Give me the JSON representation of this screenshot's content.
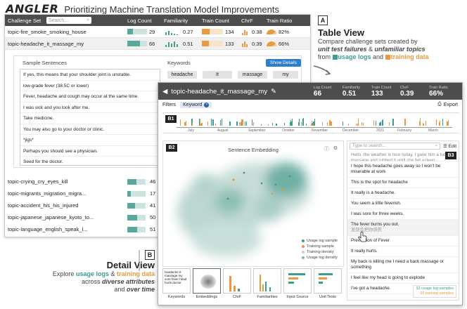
{
  "header": {
    "logo": "ANGLER",
    "subtitle": "Prioritizing Machine Translation Model Improvements"
  },
  "table": {
    "columns": {
      "challenge_set": "Challenge Set",
      "search_placeholder": "Search...",
      "log_count": "Log Count",
      "familiarity": "Familiarity",
      "train_count": "Train Count",
      "chrf": "ChrF",
      "train_ratio": "Train Ratio"
    },
    "rows": [
      {
        "name": "topic-fire_smoke_smoking_house",
        "log_count": "29",
        "familiarity": "0.27",
        "train_count": "134",
        "chrf": "0.38",
        "train_ratio": "82%"
      },
      {
        "name": "topic-headache_it_massage_my",
        "log_count": "66",
        "familiarity": "0.51",
        "train_count": "133",
        "chrf": "0.39",
        "train_ratio": "66%"
      }
    ],
    "expanded": {
      "sample_title": "Sample Sentences",
      "samples": [
        "If yes, this means that your shoulder joint is unstable.",
        "low-grade fever (38.5C or lower)",
        "Fever, headache and cough may occur at the same time.",
        "I was sick and you look after me.",
        "Take medicine.",
        "You may also go to your doctor or clinic.",
        "*jigs*",
        "Perhaps you should see a physician.",
        "Seed for the doctor."
      ],
      "keywords_title": "Keywords",
      "show_details": "Show Details",
      "keywords": [
        "headache",
        "It",
        "massage",
        "my"
      ]
    },
    "more_rows": [
      {
        "name": "topic-crying_cry_eyes_kill",
        "log_count": "46"
      },
      {
        "name": "topic-migrants_migration_migra...",
        "log_count": "17"
      },
      {
        "name": "topic-accident_his_his_injured",
        "log_count": "41"
      },
      {
        "name": "topic-japanese_japanese_kyoto_to...",
        "log_count": "50"
      },
      {
        "name": "topic-language_english_speak_l...",
        "log_count": "51"
      }
    ]
  },
  "annotation_a": {
    "badge": "A",
    "title": "Table View",
    "line1": "Compare challenge sets created by",
    "bold1": "unit test failures",
    "amp": " & ",
    "bold2": "unfamiliar topics",
    "from": "from",
    "usage": "usage logs",
    "and": "and",
    "training": "training data"
  },
  "annotation_b": {
    "badge": "B",
    "title": "Detail View",
    "explore": "Explore",
    "usage": "usage logs",
    "amp": " & ",
    "training": "training data",
    "across": "across",
    "diverse": "diverse attributes",
    "and": "and",
    "overtime": "over time"
  },
  "detail": {
    "title": "topic-headache_it_massage_my",
    "stats": [
      {
        "label": "Log Count",
        "value": "66"
      },
      {
        "label": "Familiarity",
        "value": "0.51"
      },
      {
        "label": "Train Count",
        "value": "133"
      },
      {
        "label": "ChrF",
        "value": "0.39"
      },
      {
        "label": "Train Ratio",
        "value": "66%"
      }
    ],
    "filters_label": "Filters",
    "filter_chip": "Keyword",
    "export": "Export",
    "b1": "B1",
    "b2": "B2",
    "b3": "B3",
    "timeline_labels": [
      "July",
      "August",
      "September",
      "October",
      "November",
      "December",
      "2021",
      "February",
      "March"
    ],
    "embedding_title": "Sentence Embedding",
    "legend": [
      "Usage log sample",
      "Training sample",
      "Training density",
      "Usage log density"
    ],
    "side_search_placeholder": "Type to search...",
    "edit": "Edit",
    "side_items": [
      "Hello, the weather is nice today, I gave him a tummy massage and rubbed it until she fell asleep.",
      "I hope this headache goes away so I won't be miserable at work",
      "This is the spot for headache",
      "It really is a headache.",
      "You seem a little feverish.",
      "I was sore for three weeks.",
      "The fever burns you out.",
      "Prevention of Fever",
      "It really hurts.",
      "My back is killing me I need a back massage or something",
      "I feel like my head is going to explode",
      "I've got a headache."
    ],
    "side_sub": "发烧会把你烧死",
    "side_footer": [
      "32 usage log samples",
      "66 training samples"
    ],
    "thumb_text": "headache It massage my sore fever head hurts doctor",
    "thumbs": [
      "Keywords",
      "Embeddings",
      "ChrF",
      "Familiarities",
      "Input Source",
      "Unit Tests"
    ]
  },
  "colors": {
    "usage": "#3a9d8f",
    "training": "#e89a3c",
    "header_bg": "#4d4d4d",
    "button": "#2f7fc7"
  }
}
